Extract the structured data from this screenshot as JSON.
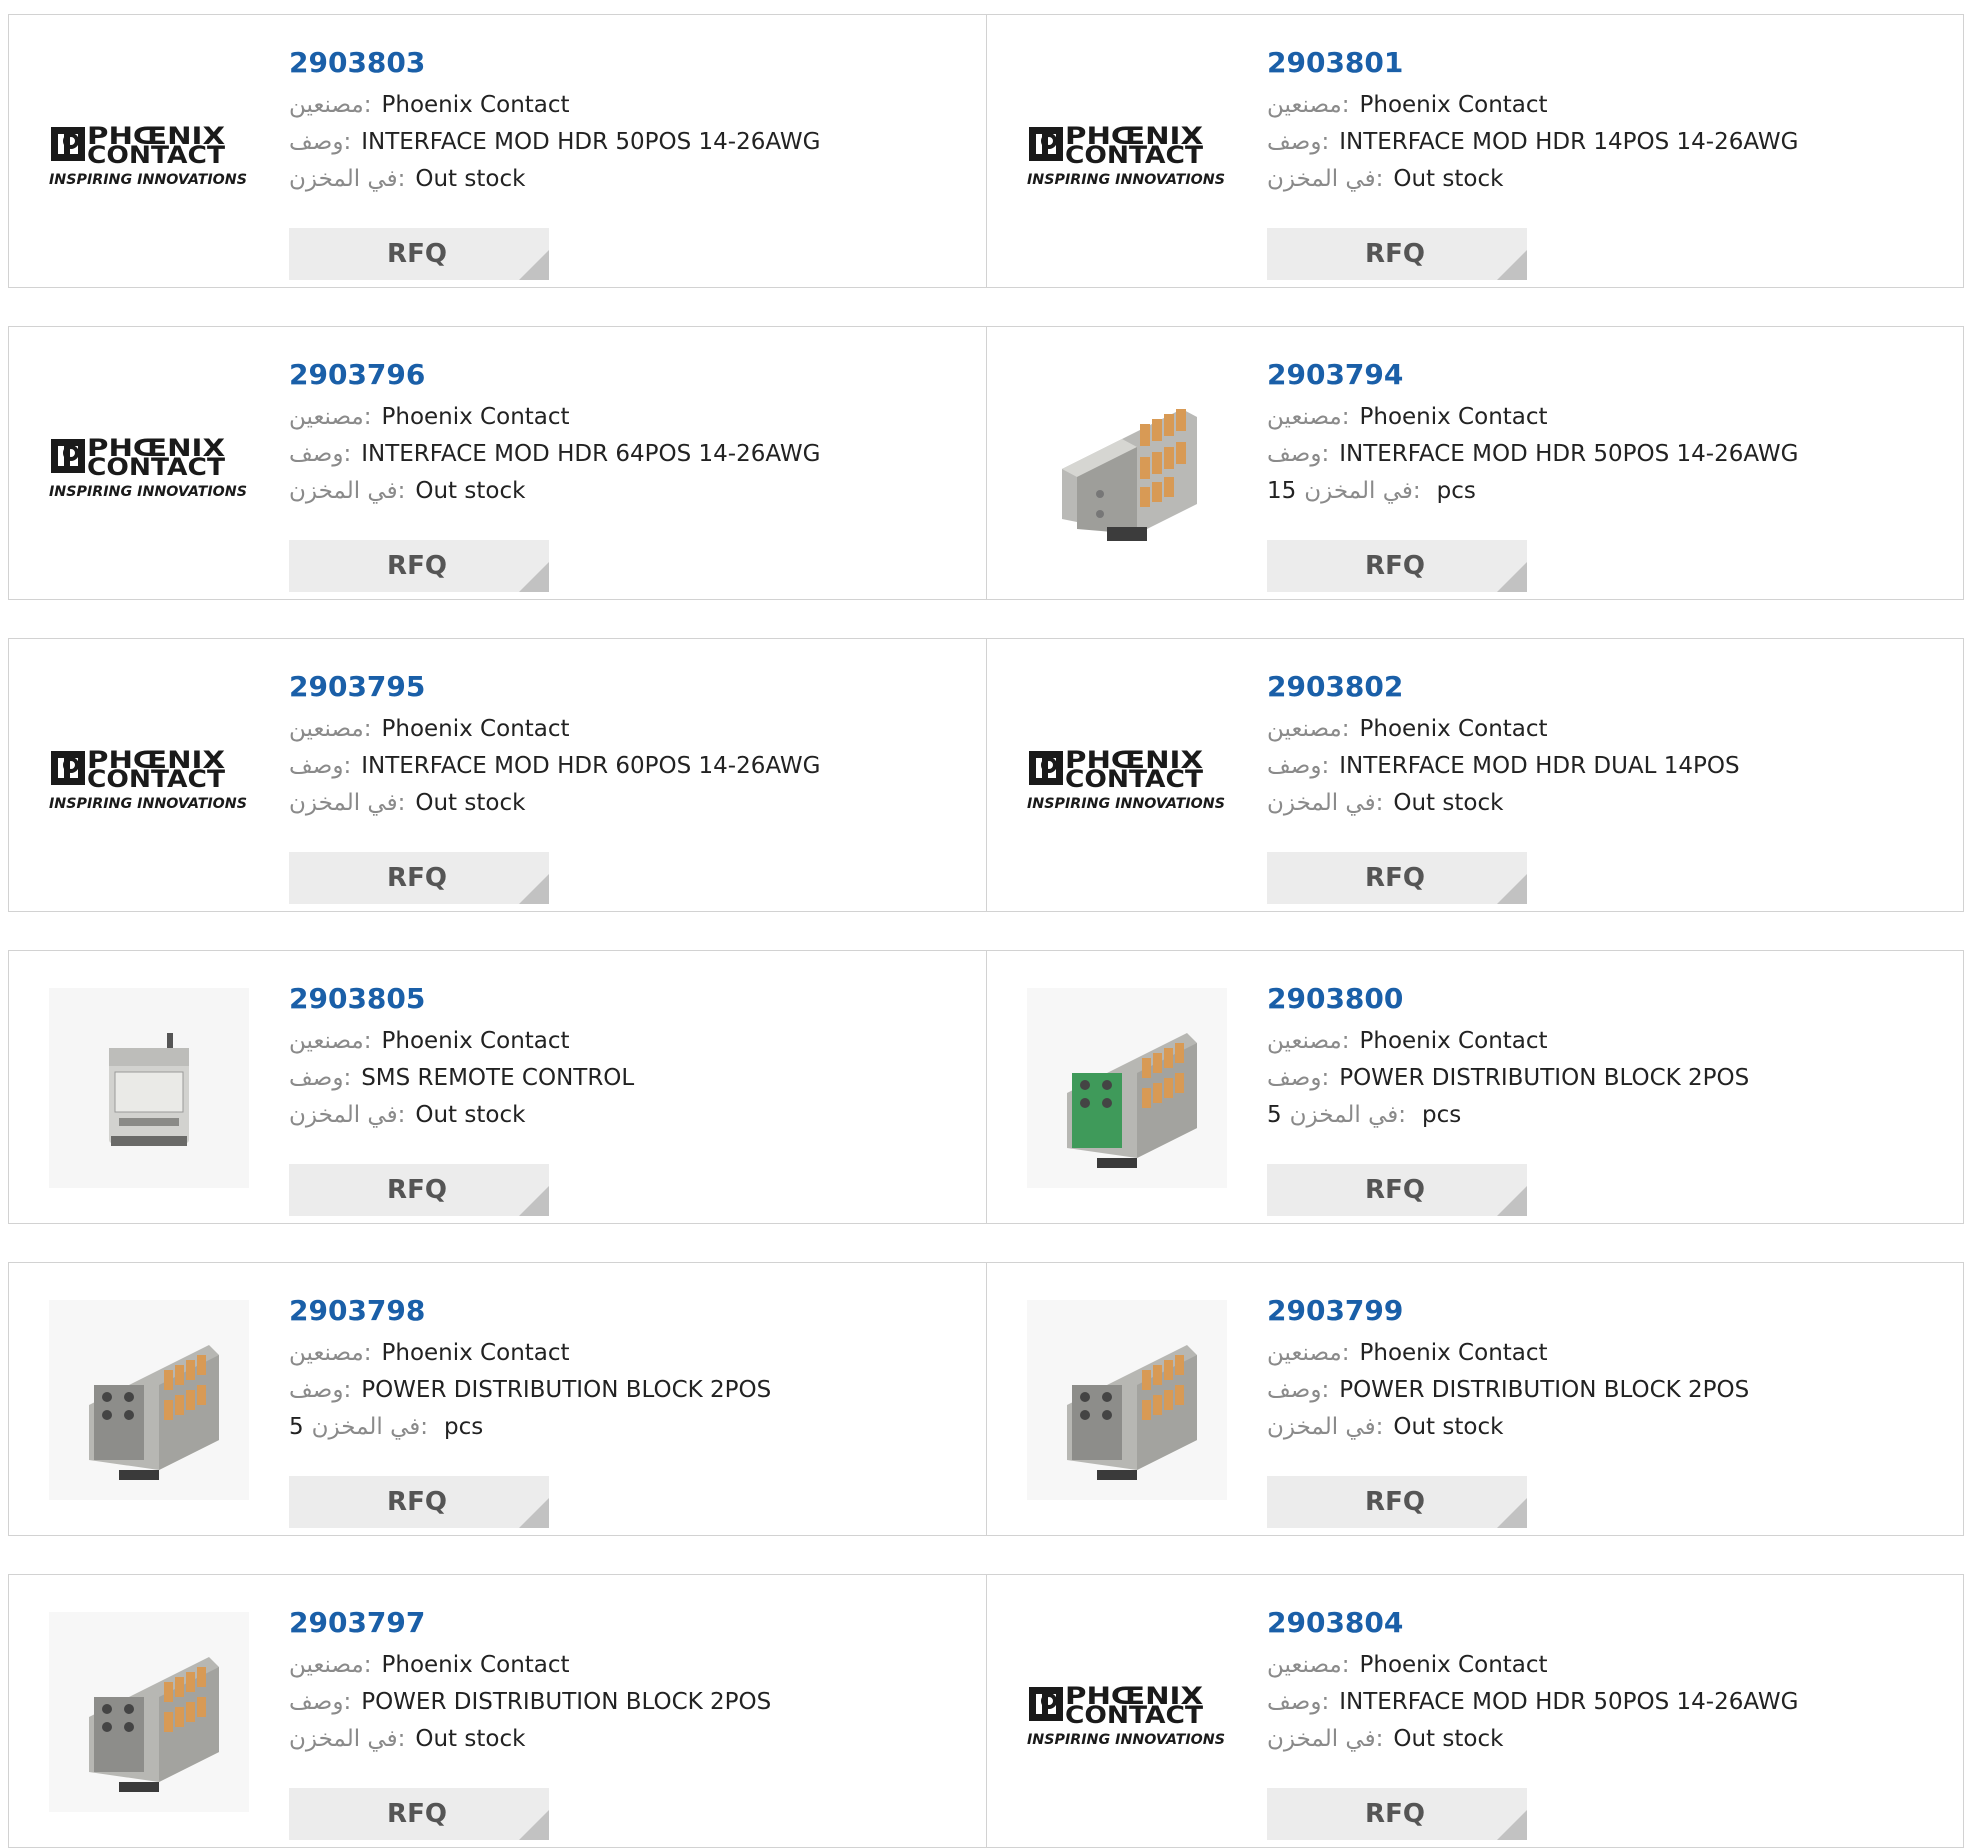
{
  "labels": {
    "manufacturer": "مصنعين:",
    "description": "وصف:",
    "stock": "في المخزن:",
    "stock_inline": "في المخزن:",
    "pcs": "pcs",
    "rfq": "RFQ"
  },
  "logo": {
    "line1": "PHŒNIX",
    "line2": "CONTACT",
    "tagline": "INSPIRING INNOVATIONS",
    "color": "#1a1a1a"
  },
  "colors": {
    "part_link": "#1a5fa8",
    "label_grey": "#8a8a8a",
    "button_bg": "#ececec",
    "button_corner": "#c2c2c2",
    "border": "#d2d2d2"
  },
  "products": [
    {
      "part": "2903803",
      "manufacturer": "Phoenix Contact",
      "description": "INTERFACE MOD HDR 50POS 14-26AWG",
      "stock": "Out stock",
      "qty": null,
      "image": "phoenix-logo"
    },
    {
      "part": "2903801",
      "manufacturer": "Phoenix Contact",
      "description": "INTERFACE MOD HDR 14POS 14-26AWG",
      "stock": "Out stock",
      "qty": null,
      "image": "phoenix-logo"
    },
    {
      "part": "2903796",
      "manufacturer": "Phoenix Contact",
      "description": "INTERFACE MOD HDR 64POS 14-26AWG",
      "stock": "Out stock",
      "qty": null,
      "image": "phoenix-logo"
    },
    {
      "part": "2903794",
      "manufacturer": "Phoenix Contact",
      "description": "INTERFACE MOD HDR 50POS 14-26AWG",
      "stock": null,
      "qty": "15",
      "image": "interface-module"
    },
    {
      "part": "2903795",
      "manufacturer": "Phoenix Contact",
      "description": "INTERFACE MOD HDR 60POS 14-26AWG",
      "stock": "Out stock",
      "qty": null,
      "image": "phoenix-logo"
    },
    {
      "part": "2903802",
      "manufacturer": "Phoenix Contact",
      "description": "INTERFACE MOD HDR DUAL 14POS",
      "stock": "Out stock",
      "qty": null,
      "image": "phoenix-logo"
    },
    {
      "part": "2903805",
      "manufacturer": "Phoenix Contact",
      "description": "SMS REMOTE CONTROL",
      "stock": "Out stock",
      "qty": null,
      "image": "sms-controller"
    },
    {
      "part": "2903800",
      "manufacturer": "Phoenix Contact",
      "description": "POWER DISTRIBUTION BLOCK 2POS",
      "stock": null,
      "qty": "5",
      "image": "distribution-block-green"
    },
    {
      "part": "2903798",
      "manufacturer": "Phoenix Contact",
      "description": "POWER DISTRIBUTION BLOCK 2POS",
      "stock": null,
      "qty": "5",
      "image": "distribution-block"
    },
    {
      "part": "2903799",
      "manufacturer": "Phoenix Contact",
      "description": "POWER DISTRIBUTION BLOCK 2POS",
      "stock": "Out stock",
      "qty": null,
      "image": "distribution-block"
    },
    {
      "part": "2903797",
      "manufacturer": "Phoenix Contact",
      "description": "POWER DISTRIBUTION BLOCK 2POS",
      "stock": "Out stock",
      "qty": null,
      "image": "distribution-block"
    },
    {
      "part": "2903804",
      "manufacturer": "Phoenix Contact",
      "description": "INTERFACE MOD HDR 50POS 14-26AWG",
      "stock": "Out stock",
      "qty": null,
      "image": "phoenix-logo"
    }
  ]
}
